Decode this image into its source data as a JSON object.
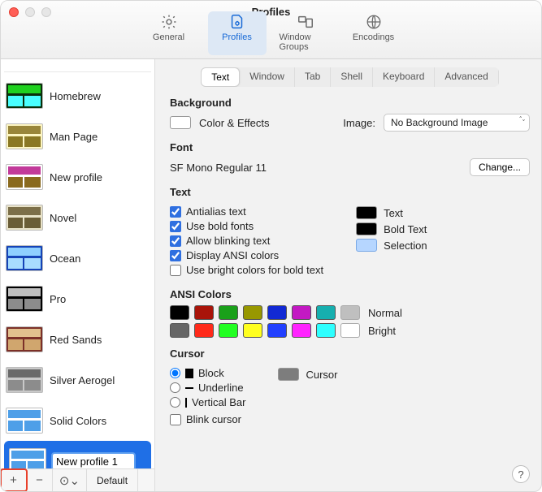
{
  "window": {
    "title": "Profiles"
  },
  "toolbar": {
    "general": "General",
    "profiles": "Profiles",
    "window_groups": "Window Groups",
    "encodings": "Encodings"
  },
  "profiles": {
    "items": [
      {
        "name": "Homebrew",
        "bg": "#0a2f0a",
        "accent1": "#1fd11f",
        "accent2": "#49ffff"
      },
      {
        "name": "Man Page",
        "bg": "#fdf6c3",
        "accent1": "#99863a",
        "accent2": "#8a7824"
      },
      {
        "name": "New profile",
        "bg": "#ffffff",
        "accent1": "#c23a9a",
        "accent2": "#8a6a1e"
      },
      {
        "name": "Novel",
        "bg": "#e9e3c9",
        "accent1": "#7c6f49",
        "accent2": "#6a5d36"
      },
      {
        "name": "Ocean",
        "bg": "#1544b8",
        "accent1": "#8fd0ff",
        "accent2": "#a8ddff"
      },
      {
        "name": "Pro",
        "bg": "#000000",
        "accent1": "#bfbfbf",
        "accent2": "#8c8c8c"
      },
      {
        "name": "Red Sands",
        "bg": "#7c3028",
        "accent1": "#e2c08e",
        "accent2": "#d0a66e"
      },
      {
        "name": "Silver Aerogel",
        "bg": "#c9c9c9",
        "accent1": "#6a6a6a",
        "accent2": "#8c8c8c"
      },
      {
        "name": "Solid Colors",
        "bg": "#ffffff",
        "accent1": "#4e9fe8",
        "accent2": "#4e9fe8"
      }
    ],
    "editing_name": "New profile 1",
    "editing_thumb": {
      "bg": "#ffffff",
      "accent1": "#4e9fe8",
      "accent2": "#4e9fe8"
    },
    "footer": {
      "add": "+",
      "remove": "−",
      "menu": "⊙⌄",
      "default": "Default"
    }
  },
  "tabs": {
    "items": [
      "Text",
      "Window",
      "Tab",
      "Shell",
      "Keyboard",
      "Advanced"
    ],
    "active_index": 0
  },
  "background": {
    "heading": "Background",
    "color_effects": "Color & Effects",
    "image_label": "Image:",
    "image_value": "No Background Image"
  },
  "font": {
    "heading": "Font",
    "value": "SF Mono Regular 11",
    "change": "Change..."
  },
  "text": {
    "heading": "Text",
    "antialias": "Antialias text",
    "bold_fonts": "Use bold fonts",
    "blinking": "Allow blinking text",
    "ansi": "Display ANSI colors",
    "bright_bold": "Use bright colors for bold text",
    "label_text": "Text",
    "label_bold": "Bold Text",
    "label_selection": "Selection"
  },
  "ansi_colors": {
    "heading": "ANSI Colors",
    "normal_label": "Normal",
    "bright_label": "Bright",
    "normal": [
      "#000000",
      "#a91409",
      "#1aa01a",
      "#989800",
      "#1229d4",
      "#c319c3",
      "#16afaf",
      "#bfbfbf"
    ],
    "bright": [
      "#666666",
      "#ff2a1a",
      "#22ff22",
      "#ffff1f",
      "#2240ff",
      "#ff24ff",
      "#2effff",
      "#ffffff"
    ]
  },
  "cursor": {
    "heading": "Cursor",
    "block": "Block",
    "underline": "Underline",
    "vbar": "Vertical Bar",
    "blink": "Blink cursor",
    "label": "Cursor"
  },
  "help": "?"
}
